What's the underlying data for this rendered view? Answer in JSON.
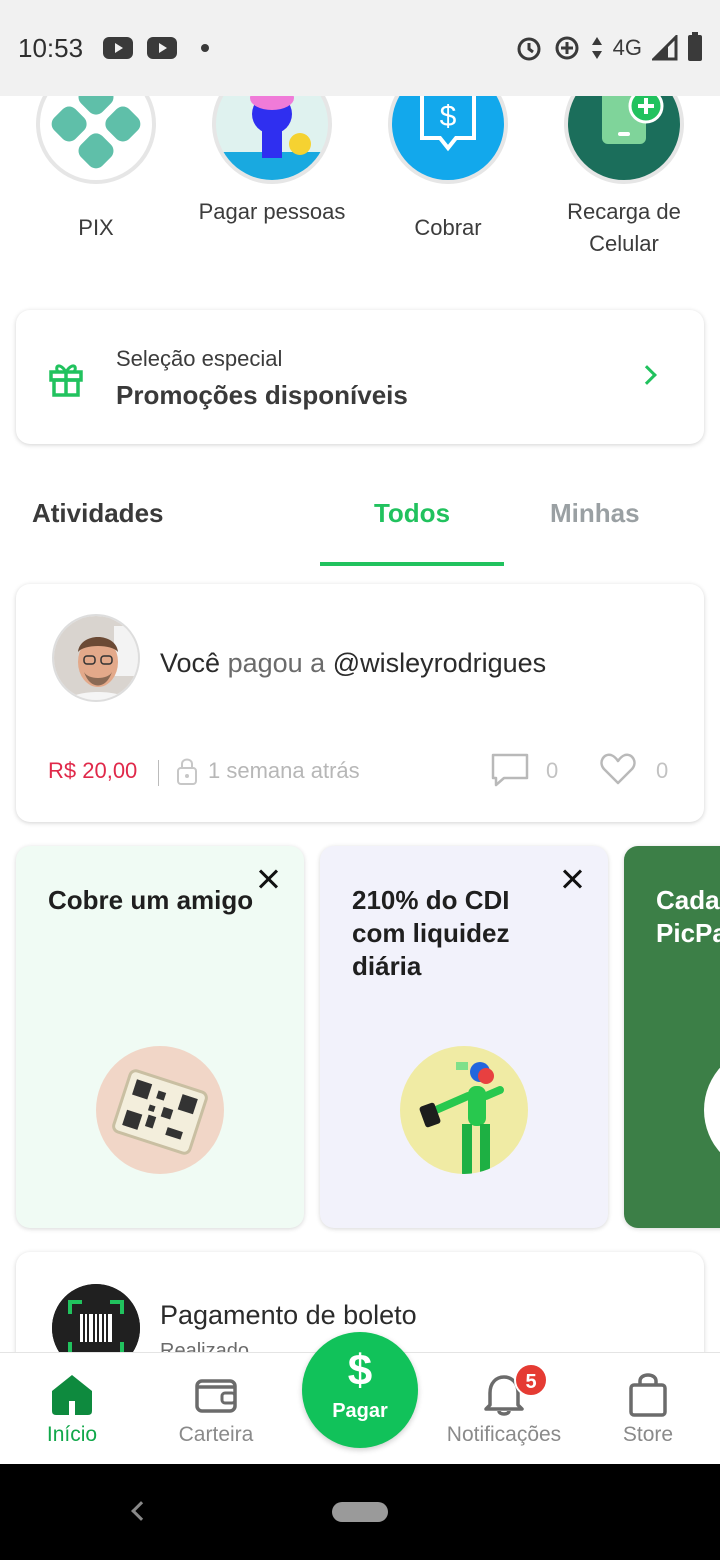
{
  "status_bar": {
    "time": "10:53",
    "network": "4G"
  },
  "shortcuts": [
    {
      "label": "PIX",
      "icon": "pix-icon"
    },
    {
      "label": "Pagar pessoas",
      "icon": "pay-people-icon"
    },
    {
      "label": "Cobrar",
      "icon": "charge-icon"
    },
    {
      "label": "Recarga de Celular",
      "icon": "phone-recharge-icon"
    }
  ],
  "promo": {
    "subtitle": "Seleção especial",
    "title": "Promoções disponíveis",
    "icon": "gift-icon"
  },
  "tabs": {
    "activities_label": "Atividades",
    "todos_label": "Todos",
    "minhas_label": "Minhas",
    "active": "Todos"
  },
  "activity": {
    "actor": "Você",
    "verb": "pagou a",
    "target": "@wisleyrodrigues",
    "amount": "R$ 20,00",
    "time": "1 semana atrás",
    "comments": "0",
    "likes": "0"
  },
  "feature_cards": [
    {
      "title": "Cobre um amigo",
      "bg": "#f0fbf4"
    },
    {
      "title": "210% do CDI com liquidez diária",
      "bg": "#f2f2fb"
    },
    {
      "title": "Cada chave PicPa",
      "bg": "#3c7f47"
    }
  ],
  "boleto": {
    "title": "Pagamento de boleto",
    "subtitle": "Realizado"
  },
  "bottom_nav": {
    "home_label": "Início",
    "wallet_label": "Carteira",
    "pay_symbol": "$",
    "pay_label": "Pagar",
    "notifications_label": "Notificações",
    "notifications_count": "5",
    "store_label": "Store"
  },
  "colors": {
    "brand_green": "#11c25a",
    "tab_active": "#21c25e",
    "amount_red": "#e0294a",
    "badge_red": "#e53b33"
  }
}
